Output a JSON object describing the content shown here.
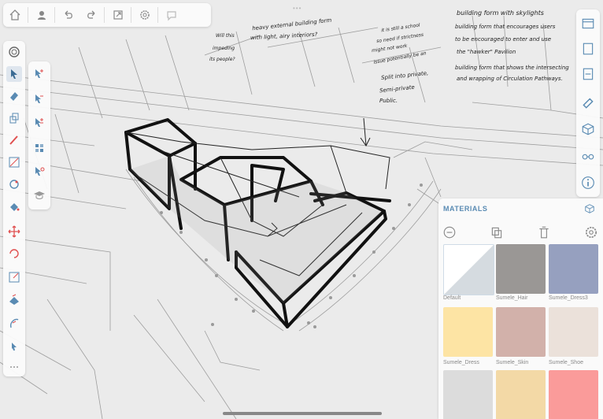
{
  "toolbar": {
    "icons": [
      "home-icon",
      "user-icon",
      "undo-icon",
      "redo-icon",
      "export-icon",
      "settings-icon",
      "comment-icon"
    ],
    "handle": "•••"
  },
  "left_tools": [
    "layers-icon",
    "select-icon",
    "eraser-icon",
    "push-pull-icon",
    "pencil-icon",
    "line-icon",
    "orbit-icon",
    "paint-bucket-icon",
    "move-icon",
    "rotate-icon",
    "scale-icon",
    "follow-me-icon",
    "offset-icon",
    "arrow-icon",
    "more-icon"
  ],
  "right_tools": [
    "scenes-icon",
    "views-icon",
    "section-icon",
    "styles-icon",
    "components-icon",
    "glasses-icon",
    "info-icon"
  ],
  "annotations": {
    "n1": "heavy external building form",
    "n2": "with light, airy interiors?",
    "n3": "Will this",
    "n4": "impeding",
    "n5": "its people?",
    "n6": "it is still a school",
    "n7": "so need if strictness",
    "n8": "might not work",
    "n9": "issue potentially be an",
    "n10": "Split into private,",
    "n11": "Semi-private",
    "n12": "Public.",
    "b1": "building form with skylights",
    "b2": "building form that encourages users",
    "b3": "to be encouraged to enter and use",
    "b4": "the \"hawker\" Pavilion",
    "b5": "building form that shows the intersecting",
    "b6": "and wrapping of Circulation Pathways."
  },
  "materials": {
    "title": "MATERIALS",
    "actions": [
      "add-material-icon",
      "duplicate-material-icon",
      "delete-material-icon",
      "settings-material-icon"
    ],
    "items": [
      {
        "label": "Default",
        "color": "#ffffff"
      },
      {
        "label": "Sumele_Hair",
        "color": "#9a9795"
      },
      {
        "label": "Sumele_Dress3",
        "color": "#96a0bf"
      },
      {
        "label": "Sumele_Dress",
        "color": "#fde4a4"
      },
      {
        "label": "Sumele_Skin",
        "color": "#d2b1aa"
      },
      {
        "label": "Sumele_Shoe",
        "color": "#ebe1da"
      },
      {
        "label": "",
        "color": "#dcdcdc"
      },
      {
        "label": "",
        "color": "#f3d9a6"
      },
      {
        "label": "",
        "color": "#fa9b9a"
      }
    ]
  }
}
